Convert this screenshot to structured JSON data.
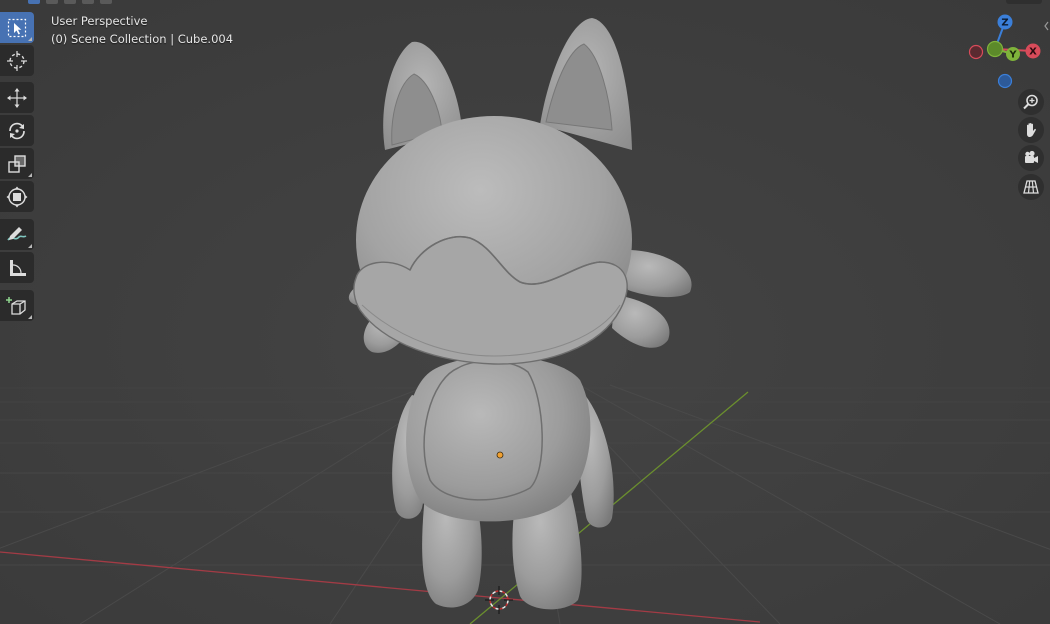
{
  "viewport": {
    "view_mode": "User Perspective",
    "scene_info": "(0) Scene Collection | Cube.004"
  },
  "toolbar": {
    "tools": [
      {
        "name": "select-box",
        "icon": "select-box-icon",
        "active": true
      },
      {
        "name": "cursor",
        "icon": "cursor-icon",
        "active": false
      },
      {
        "name": "move",
        "icon": "move-icon",
        "active": false
      },
      {
        "name": "rotate",
        "icon": "rotate-icon",
        "active": false
      },
      {
        "name": "scale",
        "icon": "scale-icon",
        "active": false
      },
      {
        "name": "transform",
        "icon": "transform-icon",
        "active": false
      },
      {
        "name": "annotate",
        "icon": "annotate-icon",
        "active": false
      },
      {
        "name": "measure",
        "icon": "measure-icon",
        "active": false
      },
      {
        "name": "add-cube",
        "icon": "add-cube-icon",
        "active": false
      }
    ]
  },
  "gizmo": {
    "axes": {
      "x": "X",
      "y": "Y",
      "z": "Z"
    },
    "colors": {
      "x": "#d94b5a",
      "y": "#7fb33b",
      "z": "#3b7fd9"
    }
  },
  "navigation": {
    "buttons": [
      "zoom-icon",
      "hand-pan-icon",
      "camera-icon",
      "grid-perspective-icon"
    ]
  },
  "colors": {
    "background": "#3d3d3d",
    "active_tool": "#4772b3",
    "grid_line": "#4a4a4a",
    "x_axis_line": "#a33b45",
    "y_axis_line": "#6b8f2e",
    "mesh": "#9a9a9a",
    "origin_dot": "#f0a030"
  }
}
